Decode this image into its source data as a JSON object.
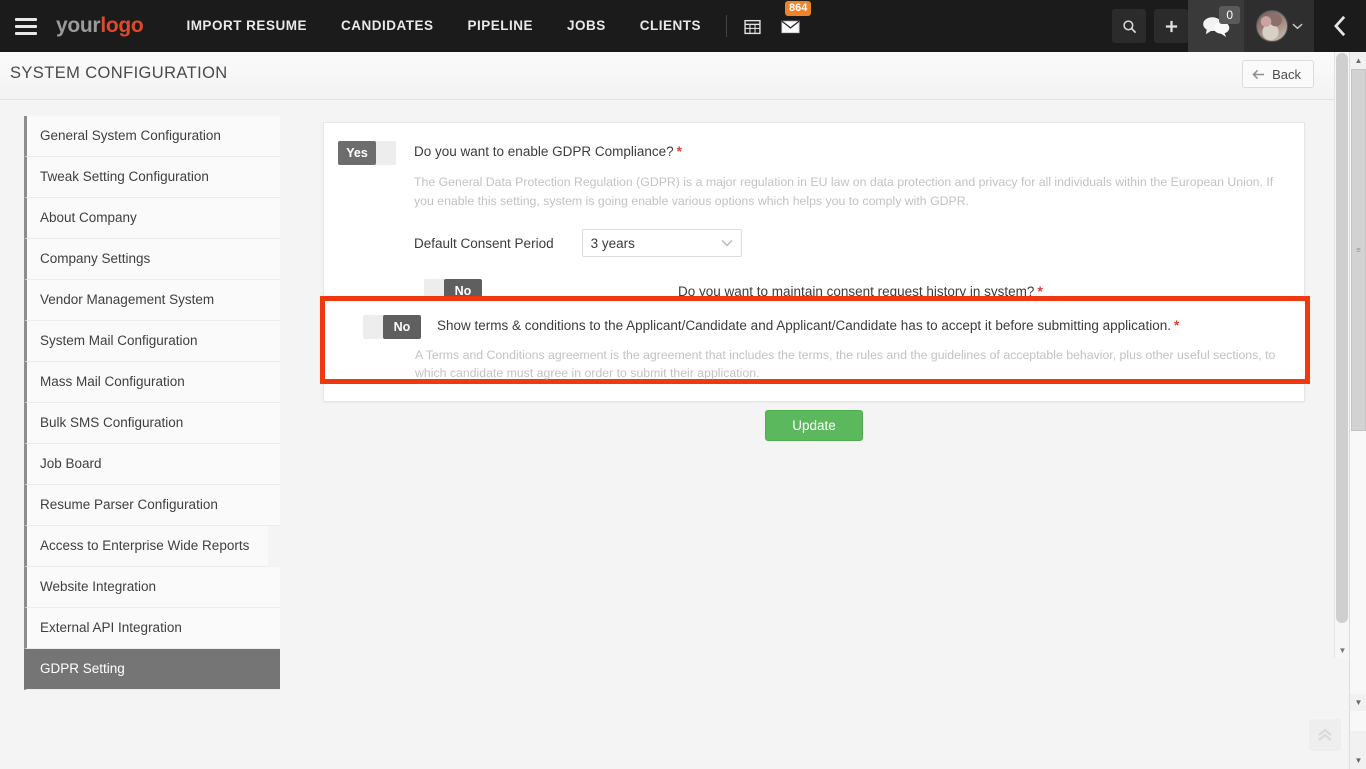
{
  "topbar": {
    "logo": {
      "part1": "your",
      "part2": "logo"
    },
    "menu_icon": "hamburger-icon",
    "nav": [
      {
        "label": "IMPORT RESUME"
      },
      {
        "label": "CANDIDATES"
      },
      {
        "label": "PIPELINE"
      },
      {
        "label": "JOBS"
      },
      {
        "label": "CLIENTS"
      }
    ],
    "calendar_icon": "calendar-icon",
    "mail_icon": "envelope-icon",
    "mail_badge": "864",
    "search_icon": "search-icon",
    "add_icon": "plus-icon",
    "chat_icon": "chat-bubbles-icon",
    "chat_count": "0",
    "avatar_icon": "user-avatar",
    "avatar_caret": "chevron-down-icon",
    "collapse_icon": "chevron-left-icon"
  },
  "pagehead": {
    "title": "SYSTEM CONFIGURATION",
    "back_label": "Back",
    "back_icon": "arrow-left-icon"
  },
  "sidebar": {
    "items": [
      {
        "label": "General System Configuration",
        "active": false
      },
      {
        "label": "Tweak Setting Configuration",
        "active": false
      },
      {
        "label": "About Company",
        "active": false
      },
      {
        "label": "Company Settings",
        "active": false
      },
      {
        "label": "Vendor Management System",
        "active": false
      },
      {
        "label": "System Mail Configuration",
        "active": false
      },
      {
        "label": "Mass Mail Configuration",
        "active": false
      },
      {
        "label": "Bulk SMS Configuration",
        "active": false
      },
      {
        "label": "Job Board",
        "active": false
      },
      {
        "label": "Resume Parser Configuration",
        "active": false
      },
      {
        "label": "Access to Enterprise Wide Reports",
        "active": false
      },
      {
        "label": "Website Integration",
        "active": false
      },
      {
        "label": "External API Integration",
        "active": false
      },
      {
        "label": "GDPR Setting",
        "active": true
      }
    ]
  },
  "main": {
    "gdpr": {
      "toggle_state": "Yes",
      "question": "Do you want to enable GDPR Compliance?",
      "required_marker": "*",
      "description": "The General Data Protection Regulation (GDPR) is a major regulation in EU law on data protection and privacy for all individuals within the European Union. If you enable this setting, system is going enable various options which helps you to comply with GDPR."
    },
    "consent_period": {
      "label": "Default Consent Period",
      "value": "3 years",
      "caret_icon": "chevron-down-icon"
    },
    "consent_history": {
      "toggle_state": "No",
      "question": "Do you want to maintain consent request history in system?",
      "required_marker": "*"
    },
    "terms": {
      "toggle_state": "No",
      "question": "Show terms & conditions to the Applicant/Candidate and Applicant/Candidate has to accept it before submitting application.",
      "required_marker": "*",
      "description": "A Terms and Conditions agreement is the agreement that includes the terms, the rules and the guidelines of acceptable behavior, plus other useful sections, to which candidate must agree in order to submit their application.",
      "highlight_color": "#f03811"
    },
    "update_label": "Update"
  },
  "scroll": {
    "up_arrow": "▲",
    "down_arrow": "▼",
    "grip": "≡",
    "to_top_icon": "chevron-up-double-icon",
    "to_top_glyph": "⌃"
  }
}
